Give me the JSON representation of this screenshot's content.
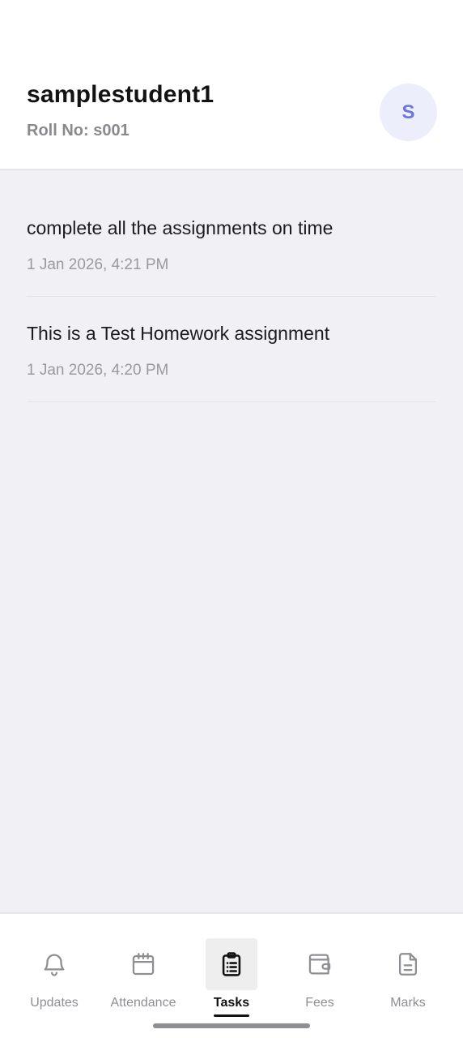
{
  "header": {
    "student_name": "samplestudent1",
    "roll_line": "Roll No: s001",
    "avatar_initial": "S"
  },
  "tasks": [
    {
      "title": "complete all the assignments on time",
      "date": "1 Jan 2026, 4:21 PM"
    },
    {
      "title": "This is a Test Homework assignment",
      "date": "1 Jan 2026, 4:20 PM"
    }
  ],
  "bottom_nav": {
    "items": [
      {
        "label": "Updates",
        "icon": "bell-icon",
        "active": false
      },
      {
        "label": "Attendance",
        "icon": "calendar-icon",
        "active": false
      },
      {
        "label": "Tasks",
        "icon": "clipboard-icon",
        "active": true
      },
      {
        "label": "Fees",
        "icon": "wallet-icon",
        "active": false
      },
      {
        "label": "Marks",
        "icon": "document-icon",
        "active": false
      }
    ]
  },
  "colors": {
    "background": "#f1f0f5",
    "avatar_bg": "#eceefb",
    "avatar_text": "#6b77d8",
    "active_tab": "#121212",
    "inactive_tab": "#8e8e93"
  }
}
